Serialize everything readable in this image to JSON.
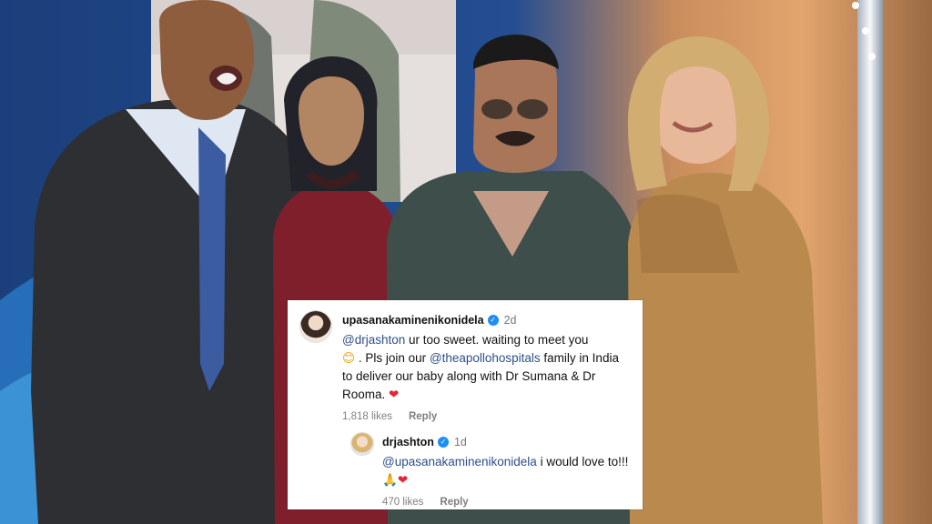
{
  "image": {
    "type": "photo",
    "description_marks": [
      "studio",
      "four-people",
      "comment-overlay"
    ]
  },
  "comments": [
    {
      "username": "upasanakaminenikonidela",
      "verified": true,
      "time": "2d",
      "text": {
        "mention": "@drjashton",
        "before_emoji": " ur too sweet. waiting to meet you",
        "emoji_smile": "😊",
        "after_emoji": " . Pls join our ",
        "mention_2": "@theapollohospitals",
        "after_mention_2": " family in India to deliver our baby along with Dr Sumana & Dr Rooma. ",
        "emoji_heart": "❤"
      },
      "likes": "1,818 likes",
      "reply": "Reply"
    },
    {
      "username": "drjashton",
      "verified": true,
      "time": "1d",
      "text": {
        "mention": "@upasanakaminenikonidela",
        "after_mention": " i would love to!!! ",
        "emoji_pray": "🙏",
        "emoji_heart": "❤"
      },
      "likes": "470 likes",
      "reply": "Reply"
    }
  ]
}
